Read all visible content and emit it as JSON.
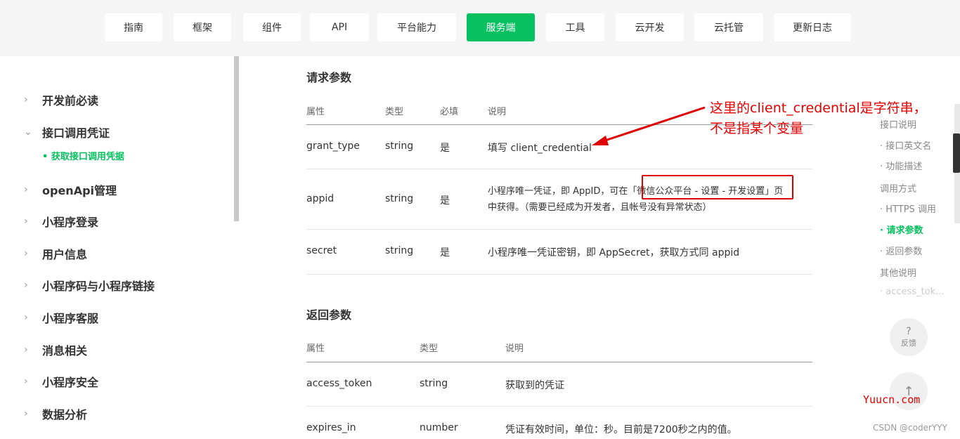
{
  "nav": {
    "items": [
      "指南",
      "框架",
      "组件",
      "API",
      "平台能力",
      "服务端",
      "工具",
      "云开发",
      "云托管",
      "更新日志"
    ],
    "active": "服务端"
  },
  "sidebar": {
    "items": [
      "开发前必读",
      "接口调用凭证",
      "openApi管理",
      "小程序登录",
      "用户信息",
      "小程序码与小程序链接",
      "小程序客服",
      "消息相关",
      "小程序安全",
      "数据分析"
    ],
    "expanded_sub": "• 获取接口调用凭据"
  },
  "request": {
    "title": "请求参数",
    "headers": [
      "属性",
      "类型",
      "必填",
      "说明"
    ],
    "rows": [
      {
        "name": "grant_type",
        "type": "string",
        "required": "是",
        "desc": "填写 client_credential"
      },
      {
        "name": "appid",
        "type": "string",
        "required": "是",
        "desc_line1": "小程序唯一凭证，即 AppID，可在「微信公众平台 - 设置 - 开发设置」页",
        "desc_line2": "中获得。（需要已经成为开发者，且帐号没有异常状态）"
      },
      {
        "name": "secret",
        "type": "string",
        "required": "是",
        "desc": "小程序唯一凭证密钥，即 AppSecret，获取方式同 appid"
      }
    ]
  },
  "response": {
    "title": "返回参数",
    "headers": [
      "属性",
      "类型",
      "说明"
    ],
    "rows": [
      {
        "name": "access_token",
        "type": "string",
        "desc": "获取到的凭证"
      },
      {
        "name": "expires_in",
        "type": "number",
        "desc": "凭证有效时间，单位：秒。目前是7200秒之内的值。"
      }
    ]
  },
  "annotation": {
    "line1": "这里的client_credential是字符串，",
    "line2": "不是指某个变量",
    "color": "#e60000"
  },
  "toc": {
    "items": [
      "接口说明",
      "· 接口英文名",
      "· 功能描述",
      "调用方式",
      "· HTTPS 调用",
      "· 请求参数",
      "· 返回参数",
      "其他说明",
      "· access_tok..."
    ],
    "active": "· 请求参数"
  },
  "feedback": {
    "icon": "?",
    "label": "反馈"
  },
  "back_top": {
    "icon": "↑"
  },
  "watermarks": {
    "site": "Yuucn.com",
    "csdn": "CSDN @coderYYY"
  },
  "colors": {
    "accent": "#07c160",
    "annotation": "#e60000"
  }
}
